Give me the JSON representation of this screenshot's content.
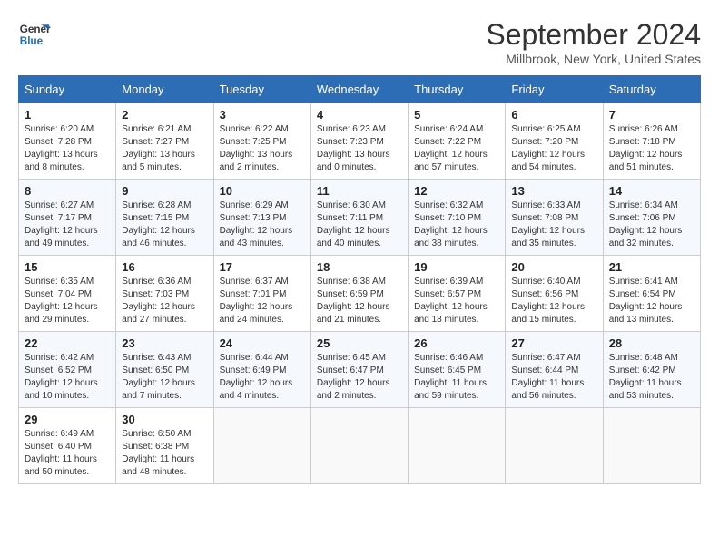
{
  "header": {
    "logo_line1": "General",
    "logo_line2": "Blue",
    "title": "September 2024",
    "subtitle": "Millbrook, New York, United States"
  },
  "days_of_week": [
    "Sunday",
    "Monday",
    "Tuesday",
    "Wednesday",
    "Thursday",
    "Friday",
    "Saturday"
  ],
  "weeks": [
    [
      {
        "day": "1",
        "info": "Sunrise: 6:20 AM\nSunset: 7:28 PM\nDaylight: 13 hours\nand 8 minutes."
      },
      {
        "day": "2",
        "info": "Sunrise: 6:21 AM\nSunset: 7:27 PM\nDaylight: 13 hours\nand 5 minutes."
      },
      {
        "day": "3",
        "info": "Sunrise: 6:22 AM\nSunset: 7:25 PM\nDaylight: 13 hours\nand 2 minutes."
      },
      {
        "day": "4",
        "info": "Sunrise: 6:23 AM\nSunset: 7:23 PM\nDaylight: 13 hours\nand 0 minutes."
      },
      {
        "day": "5",
        "info": "Sunrise: 6:24 AM\nSunset: 7:22 PM\nDaylight: 12 hours\nand 57 minutes."
      },
      {
        "day": "6",
        "info": "Sunrise: 6:25 AM\nSunset: 7:20 PM\nDaylight: 12 hours\nand 54 minutes."
      },
      {
        "day": "7",
        "info": "Sunrise: 6:26 AM\nSunset: 7:18 PM\nDaylight: 12 hours\nand 51 minutes."
      }
    ],
    [
      {
        "day": "8",
        "info": "Sunrise: 6:27 AM\nSunset: 7:17 PM\nDaylight: 12 hours\nand 49 minutes."
      },
      {
        "day": "9",
        "info": "Sunrise: 6:28 AM\nSunset: 7:15 PM\nDaylight: 12 hours\nand 46 minutes."
      },
      {
        "day": "10",
        "info": "Sunrise: 6:29 AM\nSunset: 7:13 PM\nDaylight: 12 hours\nand 43 minutes."
      },
      {
        "day": "11",
        "info": "Sunrise: 6:30 AM\nSunset: 7:11 PM\nDaylight: 12 hours\nand 40 minutes."
      },
      {
        "day": "12",
        "info": "Sunrise: 6:32 AM\nSunset: 7:10 PM\nDaylight: 12 hours\nand 38 minutes."
      },
      {
        "day": "13",
        "info": "Sunrise: 6:33 AM\nSunset: 7:08 PM\nDaylight: 12 hours\nand 35 minutes."
      },
      {
        "day": "14",
        "info": "Sunrise: 6:34 AM\nSunset: 7:06 PM\nDaylight: 12 hours\nand 32 minutes."
      }
    ],
    [
      {
        "day": "15",
        "info": "Sunrise: 6:35 AM\nSunset: 7:04 PM\nDaylight: 12 hours\nand 29 minutes."
      },
      {
        "day": "16",
        "info": "Sunrise: 6:36 AM\nSunset: 7:03 PM\nDaylight: 12 hours\nand 27 minutes."
      },
      {
        "day": "17",
        "info": "Sunrise: 6:37 AM\nSunset: 7:01 PM\nDaylight: 12 hours\nand 24 minutes."
      },
      {
        "day": "18",
        "info": "Sunrise: 6:38 AM\nSunset: 6:59 PM\nDaylight: 12 hours\nand 21 minutes."
      },
      {
        "day": "19",
        "info": "Sunrise: 6:39 AM\nSunset: 6:57 PM\nDaylight: 12 hours\nand 18 minutes."
      },
      {
        "day": "20",
        "info": "Sunrise: 6:40 AM\nSunset: 6:56 PM\nDaylight: 12 hours\nand 15 minutes."
      },
      {
        "day": "21",
        "info": "Sunrise: 6:41 AM\nSunset: 6:54 PM\nDaylight: 12 hours\nand 13 minutes."
      }
    ],
    [
      {
        "day": "22",
        "info": "Sunrise: 6:42 AM\nSunset: 6:52 PM\nDaylight: 12 hours\nand 10 minutes."
      },
      {
        "day": "23",
        "info": "Sunrise: 6:43 AM\nSunset: 6:50 PM\nDaylight: 12 hours\nand 7 minutes."
      },
      {
        "day": "24",
        "info": "Sunrise: 6:44 AM\nSunset: 6:49 PM\nDaylight: 12 hours\nand 4 minutes."
      },
      {
        "day": "25",
        "info": "Sunrise: 6:45 AM\nSunset: 6:47 PM\nDaylight: 12 hours\nand 2 minutes."
      },
      {
        "day": "26",
        "info": "Sunrise: 6:46 AM\nSunset: 6:45 PM\nDaylight: 11 hours\nand 59 minutes."
      },
      {
        "day": "27",
        "info": "Sunrise: 6:47 AM\nSunset: 6:44 PM\nDaylight: 11 hours\nand 56 minutes."
      },
      {
        "day": "28",
        "info": "Sunrise: 6:48 AM\nSunset: 6:42 PM\nDaylight: 11 hours\nand 53 minutes."
      }
    ],
    [
      {
        "day": "29",
        "info": "Sunrise: 6:49 AM\nSunset: 6:40 PM\nDaylight: 11 hours\nand 50 minutes."
      },
      {
        "day": "30",
        "info": "Sunrise: 6:50 AM\nSunset: 6:38 PM\nDaylight: 11 hours\nand 48 minutes."
      },
      {
        "day": "",
        "info": ""
      },
      {
        "day": "",
        "info": ""
      },
      {
        "day": "",
        "info": ""
      },
      {
        "day": "",
        "info": ""
      },
      {
        "day": "",
        "info": ""
      }
    ]
  ]
}
